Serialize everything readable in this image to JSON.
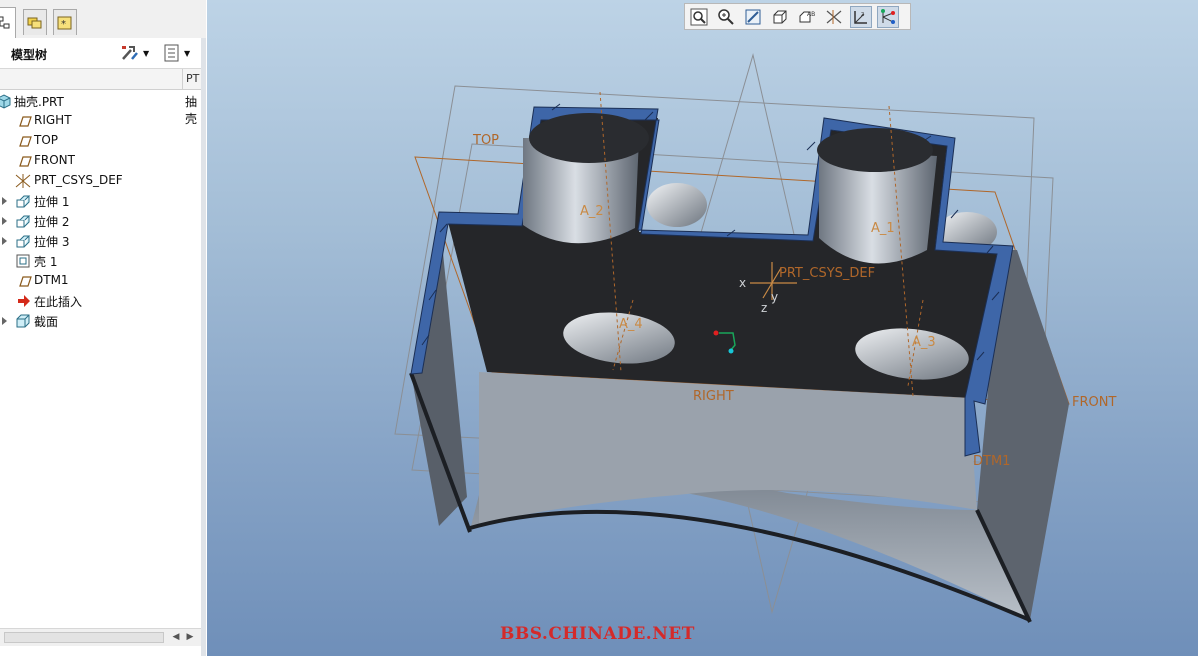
{
  "model_tree": {
    "title": "模型树",
    "column_header": "PT",
    "root": {
      "label": "抽壳.PRT",
      "extra": "抽壳"
    },
    "items": [
      {
        "label": "RIGHT",
        "icon": "datum-plane-icon",
        "expandable": false
      },
      {
        "label": "TOP",
        "icon": "datum-plane-icon",
        "expandable": false
      },
      {
        "label": "FRONT",
        "icon": "datum-plane-icon",
        "expandable": false
      },
      {
        "label": "PRT_CSYS_DEF",
        "icon": "coordinate-system-icon",
        "expandable": false
      },
      {
        "label": "拉伸 1",
        "icon": "extrude-icon",
        "expandable": true
      },
      {
        "label": "拉伸 2",
        "icon": "extrude-icon",
        "expandable": true
      },
      {
        "label": "拉伸 3",
        "icon": "extrude-icon",
        "expandable": true
      },
      {
        "label": "壳 1",
        "icon": "shell-icon",
        "expandable": false
      },
      {
        "label": "DTM1",
        "icon": "datum-plane-icon",
        "expandable": false
      },
      {
        "label": "在此插入",
        "icon": "insert-here-arrow-icon",
        "expandable": false
      },
      {
        "label": "截面",
        "icon": "section-icon",
        "expandable": true
      }
    ]
  },
  "nav_tabs": [
    "model-tree-tab-icon",
    "folder-browser-tab-icon",
    "favorites-tab-icon"
  ],
  "toolbar_icons": [
    "refit-icon",
    "zoom-in-icon",
    "repaint-icon",
    "display-style-icon",
    "saved-views-icon",
    "datum-display-icon",
    "csys-display-icon",
    "spin-center-icon"
  ],
  "viewport_labels": {
    "top": "TOP",
    "front": "FRONT",
    "right": "RIGHT",
    "dtm1": "DTM1",
    "csys": "PRT_CSYS_DEF",
    "axis_a1": "A_1",
    "axis_a2": "A_2",
    "axis_a3": "A_3",
    "axis_a4": "A_4",
    "csys_x": "x",
    "csys_y": "y",
    "csys_z": "z"
  },
  "watermark": "BBS.CHINADE.NET",
  "colors": {
    "datum": "#b0672a",
    "shell_edge": "#3e66a8",
    "watermark": "#d42a2a"
  }
}
